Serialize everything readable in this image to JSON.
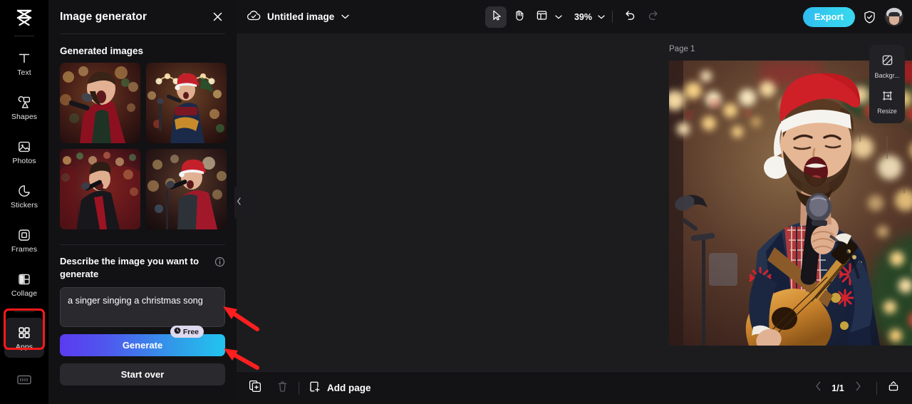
{
  "app": {
    "logo_icon": "capcut-logo-icon"
  },
  "rail": {
    "items": [
      {
        "label": "Text",
        "icon": "text-icon",
        "active": false
      },
      {
        "label": "Shapes",
        "icon": "shapes-icon",
        "active": false
      },
      {
        "label": "Photos",
        "icon": "photos-icon",
        "active": false
      },
      {
        "label": "Stickers",
        "icon": "stickers-icon",
        "active": false
      },
      {
        "label": "Frames",
        "icon": "frames-icon",
        "active": false
      },
      {
        "label": "Collage",
        "icon": "collage-icon",
        "active": false
      },
      {
        "label": "Apps",
        "icon": "apps-grid-icon",
        "active": true
      }
    ],
    "bottom_icon": "keyboard-icon",
    "highlight_color": "#ff1a1a"
  },
  "panel": {
    "title": "Image generator",
    "close_icon": "close-icon",
    "generated_section_title": "Generated images",
    "thumbnails": [
      {
        "alt": "singer in red jacket with microphone"
      },
      {
        "alt": "singer with santa hat holding guitar"
      },
      {
        "alt": "singer in black suit with microphone"
      },
      {
        "alt": "singer with santa hat in red puffer jacket"
      }
    ],
    "prompt_label": "Describe the image you want to generate",
    "info_icon": "info-icon",
    "prompt_value": "a singer singing a christmas song",
    "prompt_placeholder": "Describe the image you want to generate",
    "generate_label": "Generate",
    "free_badge": "Free",
    "free_badge_icon": "clock-icon",
    "start_over_label": "Start over",
    "collapse_icon": "chevron-left-icon"
  },
  "topbar": {
    "cloud_icon": "cloud-check-icon",
    "document_title": "Untitled image",
    "title_chevron_icon": "chevron-down-icon",
    "tools": [
      {
        "name": "select-tool",
        "icon": "cursor-arrow-icon",
        "selected": true
      },
      {
        "name": "hand-tool",
        "icon": "hand-icon",
        "selected": false
      },
      {
        "name": "layout-tool",
        "icon": "layout-panel-icon",
        "selected": false
      }
    ],
    "layout_chevron_icon": "chevron-down-icon",
    "zoom_level": "39%",
    "zoom_chevron_icon": "chevron-down-icon",
    "undo_icon": "undo-icon",
    "redo_icon": "redo-icon",
    "export_label": "Export",
    "shield_icon": "shield-check-icon",
    "avatar_icon": "user-avatar",
    "export_color": "#35d0ee"
  },
  "canvas": {
    "page_label": "Page 1",
    "page_copy_icon": "duplicate-icon",
    "artwork_alt": "man wearing santa hat singing into microphone while playing acoustic guitar with christmas lights"
  },
  "right_dock": {
    "items": [
      {
        "label": "Backgr...",
        "icon": "background-icon"
      },
      {
        "label": "Resize",
        "icon": "resize-icon"
      }
    ]
  },
  "bottombar": {
    "duplicate_page_icon": "duplicate-page-icon",
    "delete_page_icon": "trash-icon",
    "add_page_icon": "add-page-icon",
    "add_page_label": "Add page",
    "prev_page_icon": "chevron-left-icon",
    "page_indicator": "1/1",
    "next_page_icon": "chevron-right-icon",
    "thumbnails_icon": "page-thumbnails-icon"
  },
  "annotations": {
    "arrow_color": "#ff1f1f",
    "arrows": [
      {
        "name": "arrow-to-prompt-input"
      },
      {
        "name": "arrow-to-generate-button"
      }
    ]
  }
}
